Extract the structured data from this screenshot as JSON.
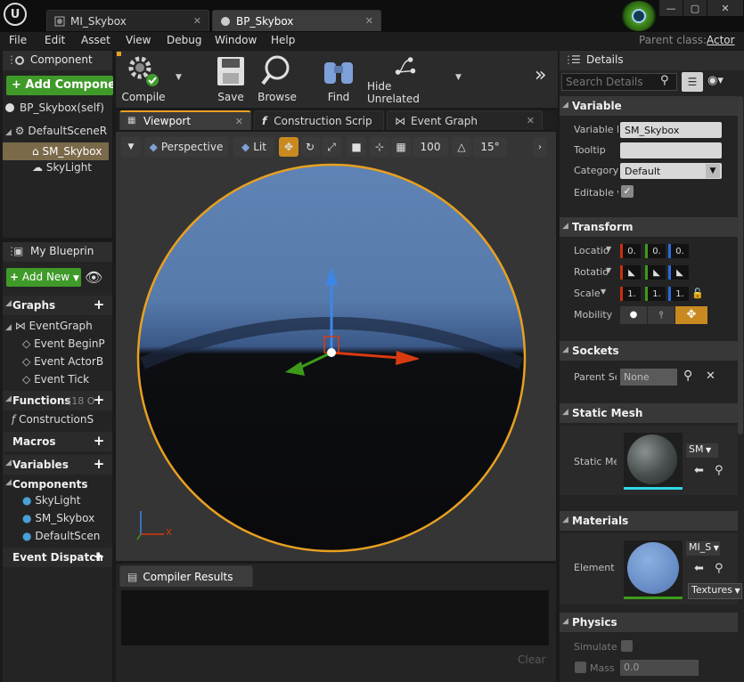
{
  "window": {
    "tabs": [
      {
        "label": "MI_Skybox"
      },
      {
        "label": "BP_Skybox"
      }
    ],
    "controls": {
      "minimize": "—",
      "maximize": "▢",
      "close": "✕"
    }
  },
  "menu": {
    "items": [
      "File",
      "Edit",
      "Asset",
      "View",
      "Debug",
      "Window",
      "Help"
    ],
    "parent_class_label": "Parent class:",
    "parent_class_value": "Actor"
  },
  "components_panel": {
    "title": "Component",
    "add_button": "+ Add Componen",
    "root": "BP_Skybox(self)",
    "tree": [
      "DefaultSceneR",
      "SM_Skybox",
      "SkyLight"
    ]
  },
  "toolbar": {
    "compile": "Compile",
    "save": "Save",
    "browse": "Browse",
    "find": "Find",
    "hide_unrelated": "Hide Unrelated",
    "overflow": "»"
  },
  "my_blueprint": {
    "title": "My Blueprin",
    "add_new": "Add New",
    "graphs": "Graphs",
    "event_graph": "EventGraph",
    "events": [
      "Event BeginP",
      "Event ActorB",
      "Event Tick"
    ],
    "functions": "Functions",
    "functions_count": "(18 O",
    "construction": "ConstructionS",
    "macros": "Macros",
    "variables": "Variables",
    "components": "Components",
    "component_items": [
      "SkyLight",
      "SM_Skybox",
      "DefaultScen"
    ],
    "event_dispatchers": "Event Dispatch"
  },
  "editor_tabs": [
    "Viewport",
    "Construction Scrip",
    "Event Graph"
  ],
  "viewport": {
    "perspective": "Perspective",
    "lit": "Lit",
    "grid_snap": "100",
    "rotation_snap": "15°",
    "axis_x": "X"
  },
  "compiler": {
    "title": "Compiler Results",
    "clear": "Clear"
  },
  "details": {
    "title": "Details",
    "search_placeholder": "Search Details",
    "variable": {
      "section": "Variable",
      "name_label": "Variable N",
      "name_value": "SM_Skybox",
      "tooltip_label": "Tooltip",
      "tooltip_value": "",
      "category_label": "Category",
      "category_value": "Default",
      "editable_label": "Editable w"
    },
    "transform": {
      "section": "Transform",
      "location_label": "Locatio",
      "rotation_label": "Rotatio",
      "scale_label": "Scale",
      "mobility_label": "Mobility",
      "location_values": [
        "0.",
        "0.",
        "0."
      ],
      "scale_values": [
        "1.",
        "1.",
        "1."
      ]
    },
    "sockets": {
      "section": "Sockets",
      "parent_label": "Parent So",
      "parent_value": "None"
    },
    "static_mesh": {
      "section": "Static Mesh",
      "label": "Static Me",
      "combo": "SM"
    },
    "materials": {
      "section": "Materials",
      "element_label": "Element 0",
      "combo": "MI_S",
      "textures": "Textures"
    },
    "physics": {
      "section": "Physics",
      "simulate_label": "Simulate",
      "mass_label": "Mass",
      "mass_value": "0.0"
    }
  },
  "colors": {
    "accent_orange": "#e8a020",
    "add_green": "#3f9a2a",
    "selection": "#7a6a4a"
  }
}
